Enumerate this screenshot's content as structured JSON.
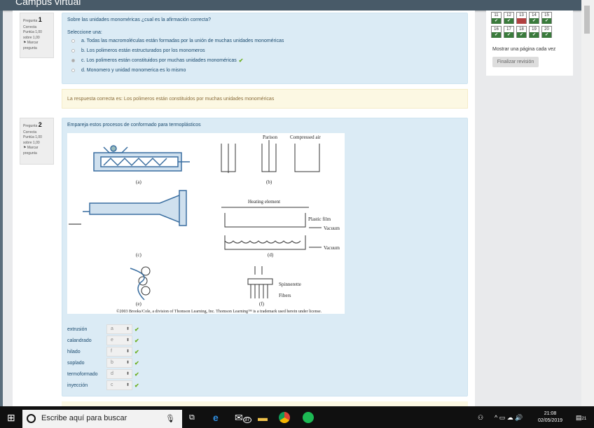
{
  "header": {
    "title": "Campus virtual"
  },
  "q1": {
    "label": "Pregunta",
    "number": "1",
    "state": "Correcta",
    "score": "Puntúa 1,00 sobre 1,00",
    "flag": "Marcar pregunta",
    "text": "Sobre las unidades monoméricas ¿cual es la afirmación correcta?",
    "prompt": "Seleccione una:",
    "options": [
      "a. Todas las macromoléculas están formadas por la unión de muchas unidades monoméricas",
      "b. Los polimeros están estructurados por los monomeros",
      "c. Los polimeros están constituidos por muchas unidades monoméricas",
      "d. Monomero y unidad monomerica es lo mismo"
    ],
    "feedback": "La respuesta correcta es: Los polimeros están constituidos por muchas unidades monoméricas"
  },
  "q2": {
    "label": "Pregunta",
    "number": "2",
    "state": "Correcta",
    "score": "Puntúa 1,00 sobre 1,00",
    "flag": "Marcar pregunta",
    "text": "Empareja estos procesos de conformado para termoplásticos",
    "figure": {
      "parison": "Parison",
      "air": "Compressed air",
      "heating": "Heating element",
      "film": "Plastic film",
      "vacuum": "Vacuum",
      "spinnerette": "Spinnerette",
      "fibers": "Fibers",
      "a": "(a)",
      "b": "(b)",
      "c": "(c)",
      "d": "(d)",
      "e": "(e)",
      "f": "(f)",
      "copyright": "©2003 Brooks/Cole, a division of Thomson Learning, Inc. Thomson Learning™ is a trademark used herein under license."
    },
    "matches": [
      {
        "label": "extrusión",
        "value": "a"
      },
      {
        "label": "calandrado",
        "value": "e"
      },
      {
        "label": "hilado",
        "value": "f"
      },
      {
        "label": "soplado",
        "value": "b"
      },
      {
        "label": "termoformado",
        "value": "d"
      },
      {
        "label": "inyección",
        "value": "c"
      }
    ]
  },
  "nav": {
    "row1": [
      "11",
      "12",
      "13",
      "14",
      "15"
    ],
    "row2": [
      "16",
      "17",
      "18",
      "19",
      "20"
    ],
    "show_all": "Mostrar una página cada vez",
    "finish": "Finalizar revisión"
  },
  "taskbar": {
    "search_placeholder": "Escribe aquí para buscar",
    "mail_badge": "37",
    "time": "21:08",
    "date": "02/05/2019",
    "notif": "21"
  }
}
